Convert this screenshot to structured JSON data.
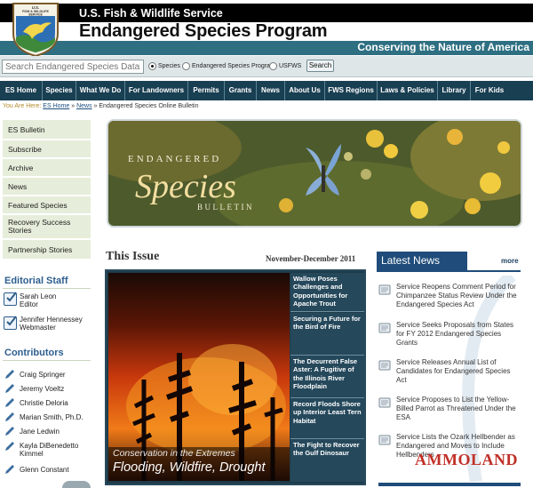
{
  "header": {
    "agency": "U.S. Fish & Wildlife Service",
    "program": "Endangered Species Program",
    "tagline": "Conserving the Nature of America",
    "logo_text": [
      "U.S.",
      "FISH & WILDLIFE",
      "SERVICE"
    ]
  },
  "search": {
    "placeholder": "Search Endangered Species Database",
    "options": [
      "Species",
      "Endangered Species Program",
      "USFWS"
    ],
    "button": "Search"
  },
  "nav": [
    "ES Home",
    "Species",
    "What We Do",
    "For Landowners",
    "Permits",
    "Grants",
    "News",
    "About Us",
    "FWS Regions",
    "Laws & Policies",
    "Library",
    "For Kids"
  ],
  "breadcrumb": {
    "prefix": "You Are Here:",
    "home": "ES Home",
    "sep1": "»",
    "news": "News",
    "sep2": "»",
    "current": "Endangered Species Online Bulletin"
  },
  "sidebar": {
    "items": [
      "ES Bulletin",
      "Subscribe",
      "Archive",
      "News",
      "Featured Species",
      "Recovery Success Stories",
      "Partnership Stories"
    ],
    "staff_heading": "Editorial Staff",
    "staff": [
      {
        "name": "Sarah Leon",
        "role": "Editor"
      },
      {
        "name": "Jennifer Hennessey",
        "role": "Webmaster"
      }
    ],
    "contributors_heading": "Contributors",
    "contributors": [
      "Craig Springer",
      "Jeremy Voeltz",
      "Christie Deloria",
      "Marian Smith, Ph.D.",
      "Jane Ledwin",
      "Kayla DiBenedetto Kimmel",
      "Glenn Constant"
    ]
  },
  "banner": {
    "line1": "ENDANGERED",
    "line2": "Species",
    "line3": "BULLETIN"
  },
  "issue": {
    "heading": "This Issue",
    "date": "November-December 2011",
    "feature_caption": "Conservation in the Extremes",
    "feature_title": "Flooding, Wildfire, Drought",
    "stories": [
      "Wallow Poses Challenges and Opportunities for Apache Trout",
      "Securing a Future for the Bird of Fire",
      "The Decurrent False Aster: A Fugitive of the Illinois River Floodplain",
      "Record Floods Shore up Interior Least Tern Habitat",
      "The Fight to Recover the Gulf Dinosaur"
    ]
  },
  "latest": {
    "heading": "Latest News",
    "more": "more",
    "items": [
      "Service Reopens Comment Period for Chimpanzee Status Review Under the Endangered Species Act",
      "Service Seeks Proposals from States for FY 2012 Endangered Species Grants",
      "Service Releases Annual List of Candidates for Endangered Species Act",
      "Service Proposes to List the Yellow-Billed Parrot as Threatened Under the ESA",
      "Service Lists the Ozark Hellbender as Endangered and Moves to Include Hellbenders"
    ]
  },
  "watermark": "AMMOLAND",
  "colors": {
    "nav": "#193f52",
    "teal": "#2e6f82",
    "accent": "#1f4c7a",
    "sidebar_bg": "#e6eedb"
  }
}
